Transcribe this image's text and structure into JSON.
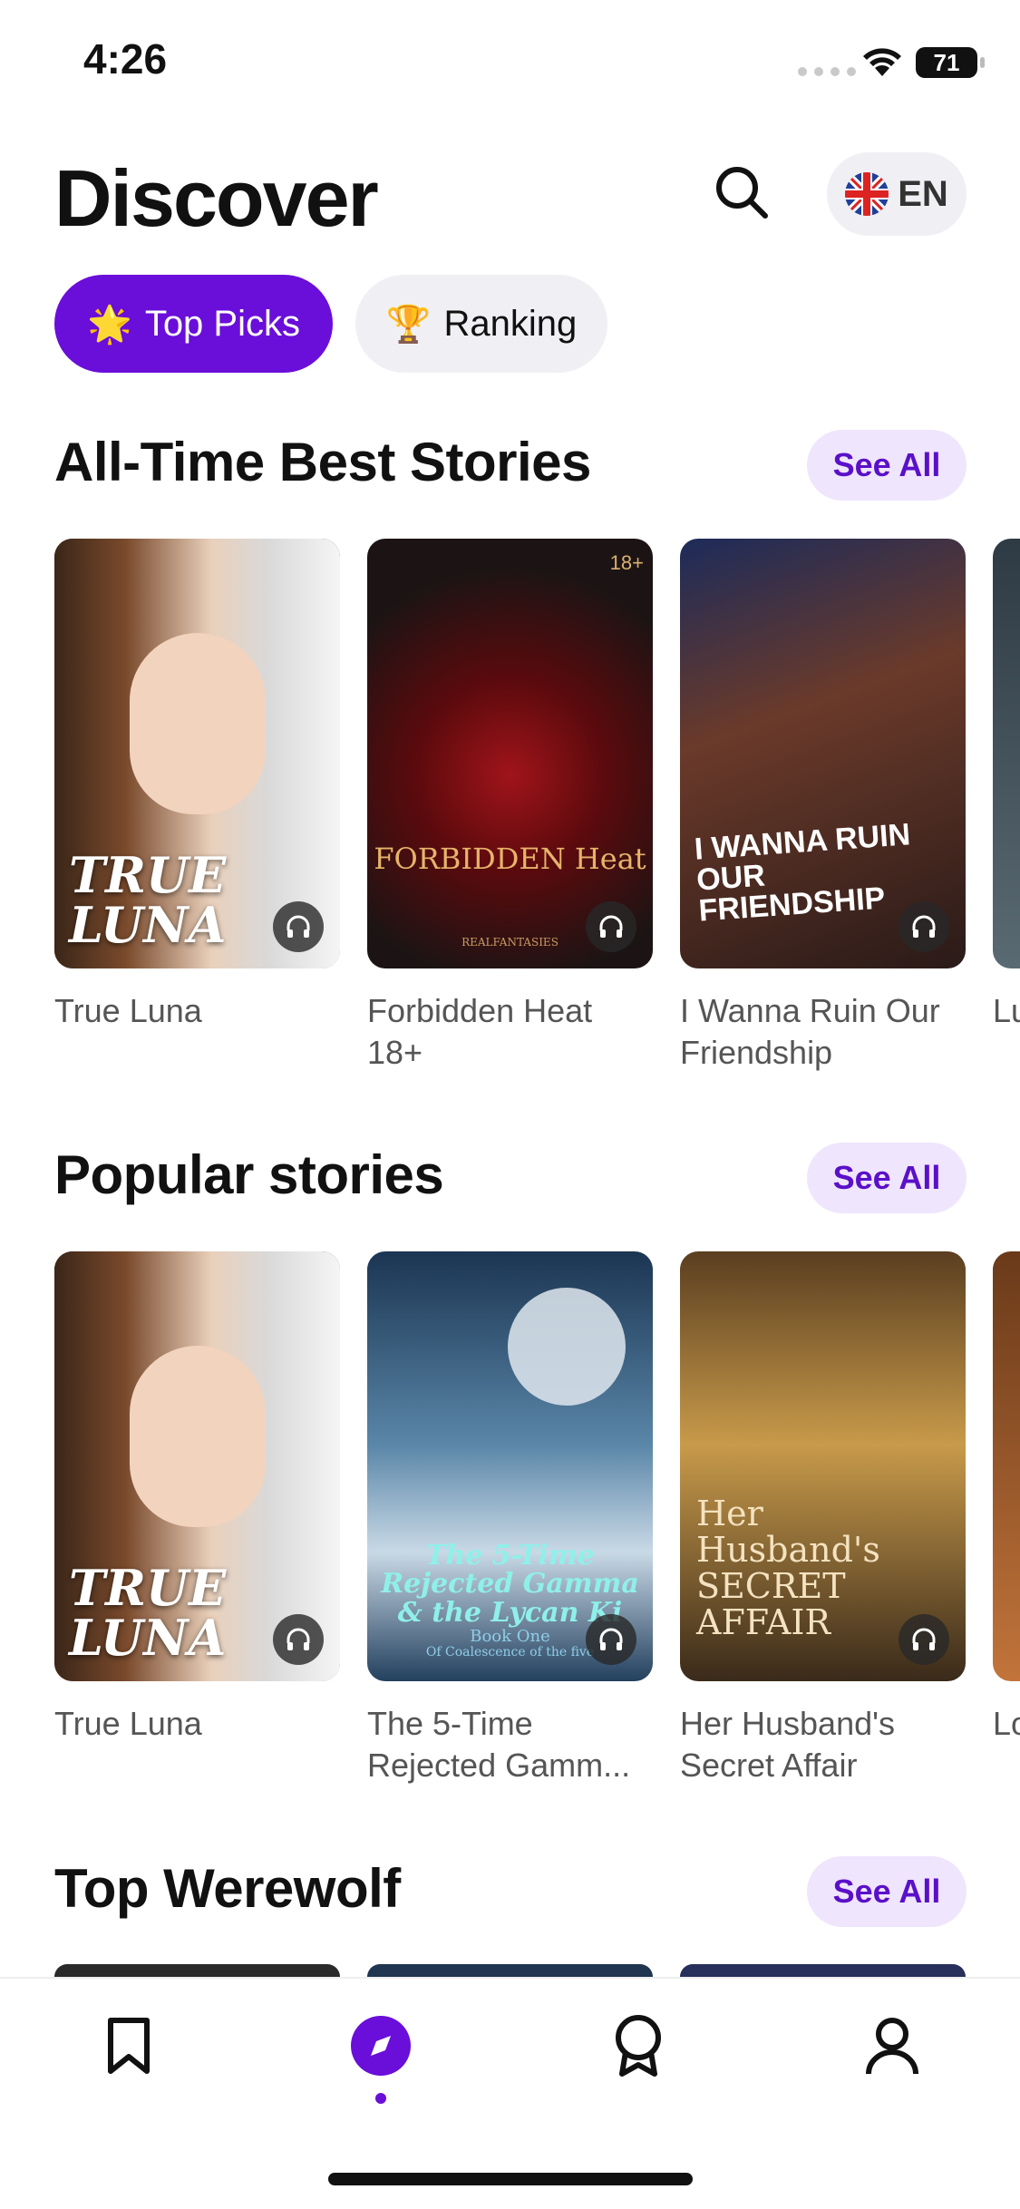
{
  "status": {
    "time": "4:26",
    "battery": "71"
  },
  "header": {
    "title": "Discover",
    "language": "EN"
  },
  "tabs": [
    {
      "label": "Top Picks",
      "emoji": "🌟",
      "active": true
    },
    {
      "label": "Ranking",
      "emoji": "🏆",
      "active": false
    }
  ],
  "see_all_label": "See All",
  "sections": [
    {
      "title": "All-Time Best Stories",
      "books": [
        {
          "name": "True Luna",
          "cover_text": "TRUE LUNA"
        },
        {
          "name": "Forbidden Heat 18+",
          "cover_text": "FORBIDDEN Heat",
          "cover_sub": "REALFANTASIES",
          "badge": "18+"
        },
        {
          "name": "I Wanna Ruin Our Friendship",
          "cover_text": "I WANNA RUIN OUR FRIENDSHIP"
        },
        {
          "name": "Lu"
        }
      ]
    },
    {
      "title": "Popular stories",
      "books": [
        {
          "name": "True Luna",
          "cover_text": "TRUE LUNA"
        },
        {
          "name": "The 5-Time Rejected Gamm...",
          "cover_text": "The 5-Time Rejected Gamma & the Lycan Ki",
          "cover_sub": "Book One",
          "cover_sub2": "Of Coalescence of the five"
        },
        {
          "name": "Her Husband's Secret Affair",
          "cover_text": "Her Husband's SECRET AFFAIR"
        },
        {
          "name": "Lo Re"
        }
      ]
    },
    {
      "title": "Top Werewolf",
      "books": []
    }
  ],
  "nav": [
    {
      "name": "library",
      "icon": "bookmark-icon"
    },
    {
      "name": "discover",
      "icon": "compass-icon",
      "active": true
    },
    {
      "name": "rewards",
      "icon": "award-icon"
    },
    {
      "name": "profile",
      "icon": "user-icon"
    }
  ],
  "colors": {
    "accent": "#6a0ed9",
    "see_all_bg": "#efe5fd",
    "see_all_text": "#5a10c9"
  }
}
